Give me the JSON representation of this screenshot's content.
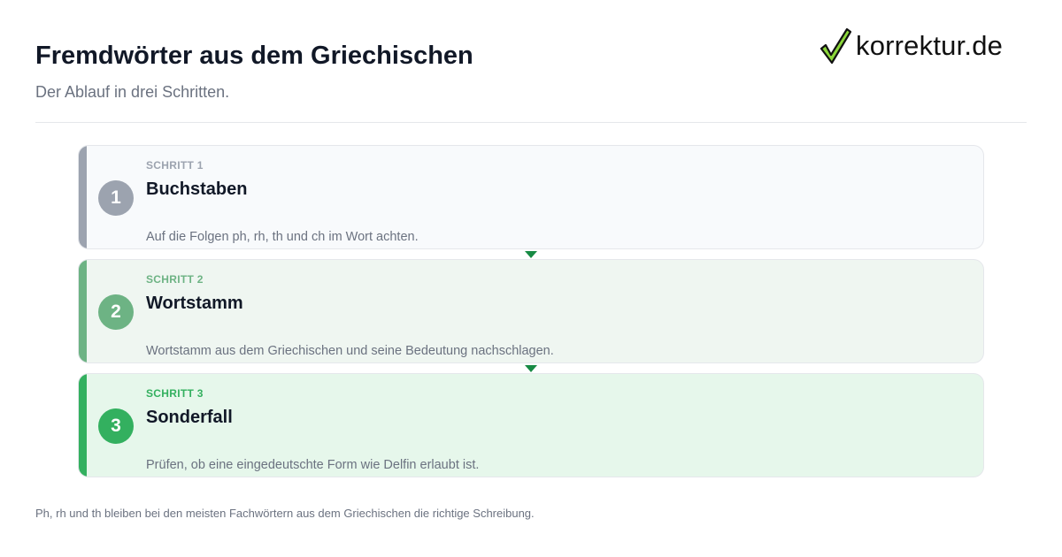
{
  "header": {
    "title": "Fremdwörter aus dem Griechischen",
    "subtitle": "Der Ablauf in drei Schritten."
  },
  "logo": {
    "text": "korrektur.de",
    "icon": "checkmark-icon",
    "check_fill": "#8bd63a",
    "check_stroke": "#111111"
  },
  "steps": [
    {
      "label": "SCHRITT 1",
      "number": "1",
      "heading": "Buchstaben",
      "description": "Auf die Folgen ph, rh, th und ch im Wort achten.",
      "accent": "#9ca3af"
    },
    {
      "label": "SCHRITT 2",
      "number": "2",
      "heading": "Wortstamm",
      "description": "Wortstamm aus dem Griechischen und seine Bedeutung nachschlagen.",
      "accent": "#6db384"
    },
    {
      "label": "SCHRITT 3",
      "number": "3",
      "heading": "Sonderfall",
      "description": "Prüfen, ob eine eingedeutschte Form wie Delfin erlaubt ist.",
      "accent": "#33b05f"
    }
  ],
  "connector_color": "#178a44",
  "footer": {
    "note": "Ph, rh und th bleiben bei den meisten Fachwörtern aus dem Griechischen die richtige Schreibung."
  }
}
